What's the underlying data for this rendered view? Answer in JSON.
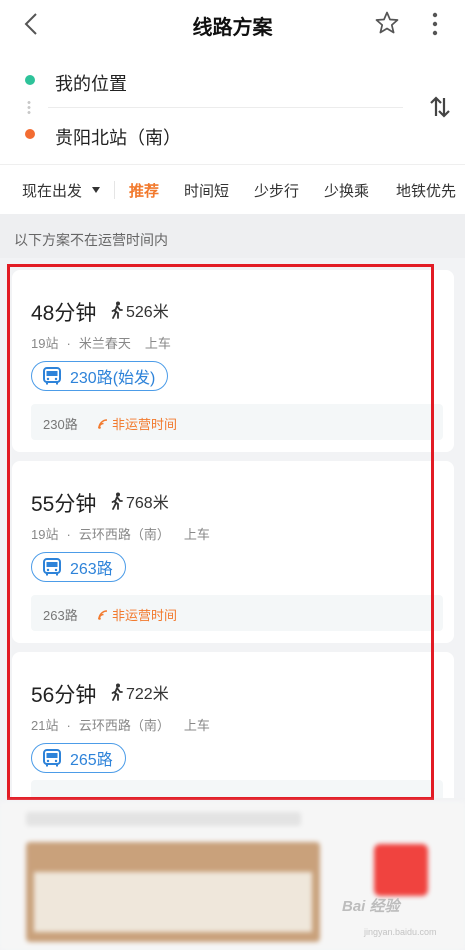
{
  "header": {
    "title": "线路方案"
  },
  "locations": {
    "from": "我的位置",
    "to": "贵阳北站（南）"
  },
  "colors": {
    "from_dot": "#2ec39a",
    "to_dot": "#f36c32",
    "accent": "#f27a2e",
    "bus_blue": "#2e83d9",
    "highlight": "#e21b24"
  },
  "filters": {
    "depart": "现在出发",
    "tabs": [
      "推荐",
      "时间短",
      "少步行",
      "少换乘",
      "地铁优先"
    ]
  },
  "notice": "以下方案不在运营时间内",
  "routes": [
    {
      "duration": "48分钟",
      "walk": "526米",
      "stations": "19站",
      "stop": "米兰春天",
      "board": "上车",
      "bus": "230路(始发)",
      "status_route": "230路",
      "status": "非运营时间"
    },
    {
      "duration": "55分钟",
      "walk": "768米",
      "stations": "19站",
      "stop": "云环西路（南）",
      "board": "上车",
      "bus": "263路",
      "status_route": "263路",
      "status": "非运营时间"
    },
    {
      "duration": "56分钟",
      "walk": "722米",
      "stations": "21站",
      "stop": "云环西路（南）",
      "board": "上车",
      "bus": "265路"
    }
  ],
  "watermark": {
    "text": "Bai 经验",
    "sub": "jingyan.baidu.com"
  },
  "icons": {
    "back": "chevron-left-icon",
    "star": "star-icon",
    "more": "more-vertical-icon",
    "swap": "swap-icon",
    "walk": "walk-icon",
    "bus": "bus-icon",
    "signal": "signal-icon"
  }
}
